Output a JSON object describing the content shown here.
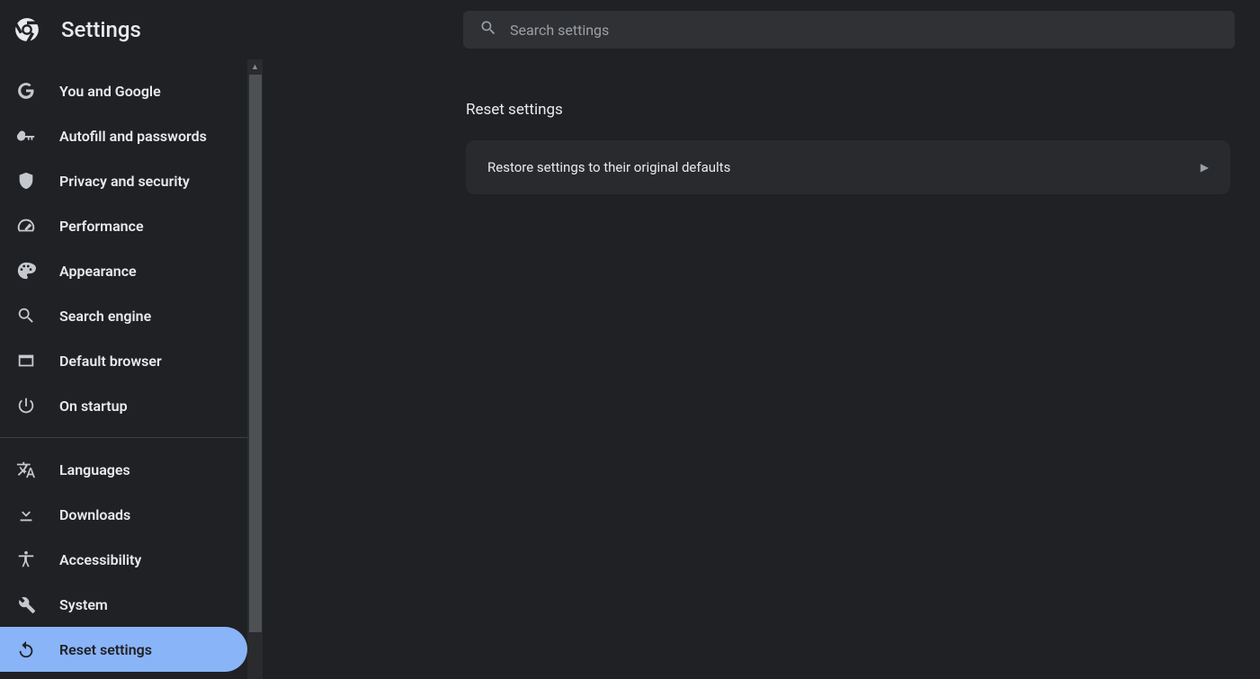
{
  "header": {
    "title": "Settings",
    "search_placeholder": "Search settings"
  },
  "sidebar": {
    "group1": [
      {
        "id": "you-and-google",
        "label": "You and Google",
        "icon": "google-g-icon"
      },
      {
        "id": "autofill",
        "label": "Autofill and passwords",
        "icon": "key-icon"
      },
      {
        "id": "privacy",
        "label": "Privacy and security",
        "icon": "shield-icon"
      },
      {
        "id": "performance",
        "label": "Performance",
        "icon": "speedometer-icon"
      },
      {
        "id": "appearance",
        "label": "Appearance",
        "icon": "palette-icon"
      },
      {
        "id": "search-engine",
        "label": "Search engine",
        "icon": "search-icon"
      },
      {
        "id": "default-browser",
        "label": "Default browser",
        "icon": "browser-window-icon"
      },
      {
        "id": "on-startup",
        "label": "On startup",
        "icon": "power-icon"
      }
    ],
    "group2": [
      {
        "id": "languages",
        "label": "Languages",
        "icon": "translate-icon"
      },
      {
        "id": "downloads",
        "label": "Downloads",
        "icon": "download-icon"
      },
      {
        "id": "accessibility",
        "label": "Accessibility",
        "icon": "accessibility-icon"
      },
      {
        "id": "system",
        "label": "System",
        "icon": "wrench-icon"
      },
      {
        "id": "reset",
        "label": "Reset settings",
        "icon": "reset-icon",
        "active": true
      }
    ]
  },
  "main": {
    "section_title": "Reset settings",
    "rows": [
      {
        "id": "restore-defaults",
        "label": "Restore settings to their original defaults"
      }
    ]
  }
}
